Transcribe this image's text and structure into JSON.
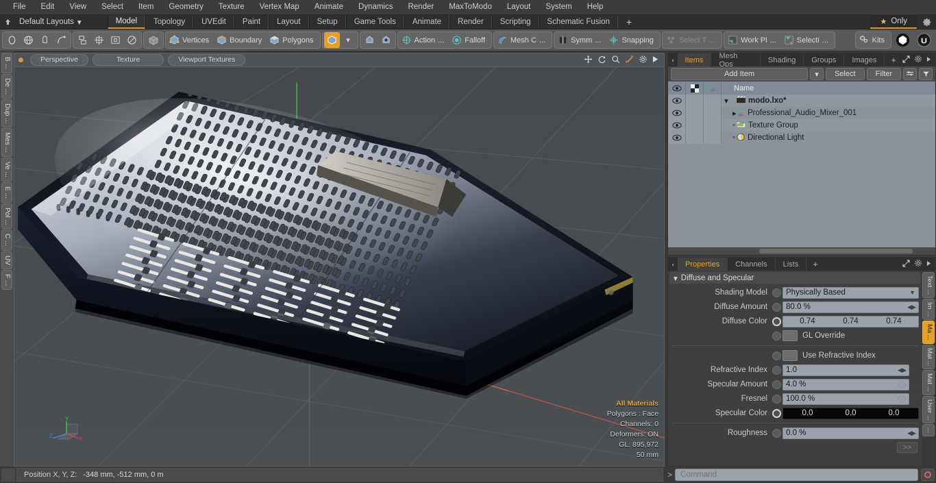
{
  "menubar": {
    "items": [
      "File",
      "Edit",
      "View",
      "Select",
      "Item",
      "Geometry",
      "Texture",
      "Vertex Map",
      "Animate",
      "Dynamics",
      "Render",
      "MaxToModo",
      "Layout",
      "System",
      "Help"
    ]
  },
  "layoutbar": {
    "home_icon": "home-arrow-icon",
    "default_layouts": "Default Layouts",
    "dropdown_caret": "▾",
    "tabs": [
      {
        "label": "Model",
        "active": true
      },
      {
        "label": "Topology",
        "active": false
      },
      {
        "label": "UVEdit",
        "active": false
      },
      {
        "label": "Paint",
        "active": false
      },
      {
        "label": "Layout",
        "active": false
      },
      {
        "label": "Setup",
        "active": false
      },
      {
        "label": "Game Tools",
        "active": false
      },
      {
        "label": "Animate",
        "active": false
      },
      {
        "label": "Render",
        "active": false
      },
      {
        "label": "Scripting",
        "active": false
      },
      {
        "label": "Schematic Fusion",
        "active": false
      }
    ],
    "add_tab": "+",
    "only_label": "Only",
    "only_star": "★",
    "gear_icon": "gear-icon",
    "accent_color": "#d79a3a"
  },
  "toolbar": {
    "shape_tools": [
      "circle-icon",
      "sphere-icon",
      "pen-icon",
      "curve-icon"
    ],
    "arrange_tools": [
      "mirror-icon",
      "align-icon",
      "center-icon",
      "radial-icon"
    ],
    "cube_icon": "cube-icon",
    "selection_modes": [
      {
        "label": "Vertices",
        "icon": "vertices-icon"
      },
      {
        "label": "Boundary",
        "icon": "boundary-icon"
      },
      {
        "label": "Polygons",
        "icon": "polygons-icon"
      }
    ],
    "item_mode_icon": "item-mode-icon",
    "item_caret": "▾",
    "mode_icons": [
      "select-a-icon",
      "select-b-icon"
    ],
    "modifiers": [
      {
        "label": "Action",
        "suffix": "...",
        "icon": "action-center-icon"
      },
      {
        "label": "Falloff",
        "suffix": "",
        "icon": "falloff-icon"
      },
      {
        "label": "Mesh C",
        "suffix": "...",
        "icon": "mesh-constraint-icon"
      },
      {
        "label": "Symm",
        "suffix": "...",
        "icon": "symmetry-icon"
      },
      {
        "label": "Snapping",
        "suffix": "",
        "icon": "snapping-icon"
      },
      {
        "label": "Select T",
        "suffix": "...",
        "icon": "select-through-icon",
        "dim": true
      },
      {
        "label": "Work Pl",
        "suffix": "...",
        "icon": "work-plane-icon"
      },
      {
        "label": "Selecti",
        "suffix": "...",
        "icon": "selection-set-icon"
      }
    ],
    "kits_label": "Kits",
    "kits_icon": "kits-gears-icon",
    "right_icons": [
      "modo-ball-icon",
      "unreal-icon"
    ]
  },
  "left_tabs": [
    "B ...",
    "De ...",
    "Dup ...",
    "Mes ...",
    "Ve ...",
    "E ...",
    "Pol ...",
    "C ...",
    "UV",
    "F ..."
  ],
  "viewport": {
    "header": {
      "indicator": "active-dot",
      "pills": [
        "Perspective",
        "Texture",
        "Viewport Textures"
      ],
      "icons": [
        "pan-icon",
        "rotate-icon",
        "zoom-icon",
        "fit-icon",
        "gear-icon",
        "play-icon"
      ],
      "active_icon": "fit-icon"
    },
    "stats": {
      "materials": "All Materials",
      "polygons": "Polygons : Face",
      "channels": "Channels: 0",
      "deformers": "Deformers: ON",
      "gl": "GL: 895,972",
      "scale": "50 mm"
    },
    "axis_gizmo": {
      "x": "X",
      "y": "Y",
      "z": "Z",
      "x_color": "#d04545",
      "y_color": "#3fc040",
      "z_color": "#4a7fe0"
    },
    "background_color": "#474c50",
    "model_name": "Professional Audio Mixer"
  },
  "items_panel": {
    "tabs": [
      {
        "label": "Items",
        "active": true
      },
      {
        "label": "Mesh Ops",
        "active": false
      },
      {
        "label": "Shading",
        "active": false
      },
      {
        "label": "Groups",
        "active": false
      },
      {
        "label": "Images",
        "active": false
      }
    ],
    "add_tab": "+",
    "add_item_label": "Add Item",
    "add_item_caret": "▾",
    "select_label": "Select",
    "filter_label": "Filter",
    "columns": [
      "eye-icon",
      "checker-icon",
      "axis-icon",
      "Name"
    ],
    "name_column_label": "Name",
    "rows": [
      {
        "name": "modo.lxo*",
        "icon": "scene-clapper-icon",
        "indent": 0,
        "expanded": true,
        "bold": true
      },
      {
        "name": "Professional_Audio_Mixer_001",
        "icon": "mesh-axis-icon",
        "indent": 1,
        "expanded": false,
        "bold": false
      },
      {
        "name": "Texture Group",
        "icon": "texture-group-icon",
        "indent": 1,
        "expanded": null,
        "bold": false
      },
      {
        "name": "Directional Light",
        "icon": "light-icon",
        "indent": 1,
        "expanded": null,
        "bold": false
      }
    ]
  },
  "properties_panel": {
    "tabs": [
      {
        "label": "Properties",
        "active": true
      },
      {
        "label": "Channels",
        "active": false
      },
      {
        "label": "Lists",
        "active": false
      }
    ],
    "add_tab": "+",
    "group_title": "Diffuse and Specular",
    "group_caret": "▾",
    "fields": [
      {
        "type": "dropdown",
        "label": "Shading Model",
        "value": "Physically Based"
      },
      {
        "type": "slider",
        "label": "Diffuse Amount",
        "value": "80.0 %"
      },
      {
        "type": "color",
        "label": "Diffuse Color",
        "values": [
          "0.74",
          "0.74",
          "0.74"
        ],
        "swatch": "#bcbcbc",
        "dark": false
      },
      {
        "type": "checkbox",
        "label": "GL Override",
        "checked": false
      },
      {
        "type": "checkbox",
        "label": "Use Refractive Index",
        "checked": false
      },
      {
        "type": "slider_dd",
        "label": "Refractive Index",
        "value": "1.0"
      },
      {
        "type": "slider_g",
        "label": "Specular Amount",
        "value": "4.0 %"
      },
      {
        "type": "slider_g",
        "label": "Fresnel",
        "value": "100.0 %"
      },
      {
        "type": "color",
        "label": "Specular Color",
        "values": [
          "0.0",
          "0.0",
          "0.0"
        ],
        "swatch": "#000000",
        "dark": true
      },
      {
        "type": "slider",
        "label": "Roughness",
        "value": "0.0 %"
      }
    ],
    "more_label": ">>"
  },
  "right_tabs": [
    {
      "label": "Text ...",
      "active": false
    },
    {
      "label": "Im ...",
      "active": false
    },
    {
      "label": "Ma ...",
      "active": true
    },
    {
      "label": "Mat ...",
      "active": false
    },
    {
      "label": "Mat ...",
      "active": false
    },
    {
      "label": "User ...",
      "active": false
    },
    {
      "label": "...",
      "active": false
    }
  ],
  "statusbar": {
    "position_label": "Position X, Y, Z:",
    "position_value": "-348 mm, -512 mm, 0 m"
  },
  "commandbar": {
    "prompt": ">",
    "placeholder": "Command",
    "record_icon": "record-icon"
  }
}
